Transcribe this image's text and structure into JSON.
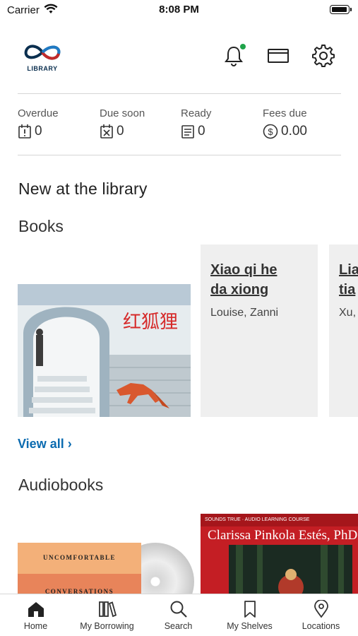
{
  "status_bar": {
    "carrier": "Carrier",
    "time": "8:08 PM"
  },
  "header": {
    "logo_text": "LIBRARY"
  },
  "stats": [
    {
      "label": "Overdue",
      "value": "0",
      "icon": "alert-card-icon"
    },
    {
      "label": "Due soon",
      "value": "0",
      "icon": "calendar-x-icon"
    },
    {
      "label": "Ready",
      "value": "0",
      "icon": "book-ready-icon"
    },
    {
      "label": "Fees due",
      "value": "0.00",
      "icon": "dollar-circle-icon"
    }
  ],
  "main": {
    "section_title": "New at the library",
    "books": {
      "title": "Books",
      "items": [
        {
          "cover_title": "红狐狸",
          "kind": "cover"
        },
        {
          "title_line1": "Xiao qi he",
          "title_line2": "da xiong",
          "author": "Louise, Zanni",
          "kind": "placeholder"
        },
        {
          "title_line1": "Lia",
          "title_line2": "tia",
          "author": "Xu,",
          "kind": "placeholder"
        }
      ],
      "view_all": "View all ›"
    },
    "audiobooks": {
      "title": "Audiobooks",
      "items": [
        {
          "cover_line1": "UNCOMFORTABLE",
          "cover_line2": "CONVERSATIONS"
        },
        {
          "cover_author": "Clarissa Pinkola Estés, PhD",
          "cover_top": "SOUNDS TRUE · AUDIO LEARNING COURSE"
        }
      ]
    }
  },
  "tabbar": [
    {
      "label": "Home",
      "icon": "home-icon"
    },
    {
      "label": "My Borrowing",
      "icon": "books-icon"
    },
    {
      "label": "Search",
      "icon": "search-icon"
    },
    {
      "label": "My Shelves",
      "icon": "bookmark-icon"
    },
    {
      "label": "Locations",
      "icon": "location-pin-icon"
    }
  ],
  "colors": {
    "accent": "#0b6bb0",
    "notification": "#1fa34a",
    "divider": "#d6d6d6"
  }
}
